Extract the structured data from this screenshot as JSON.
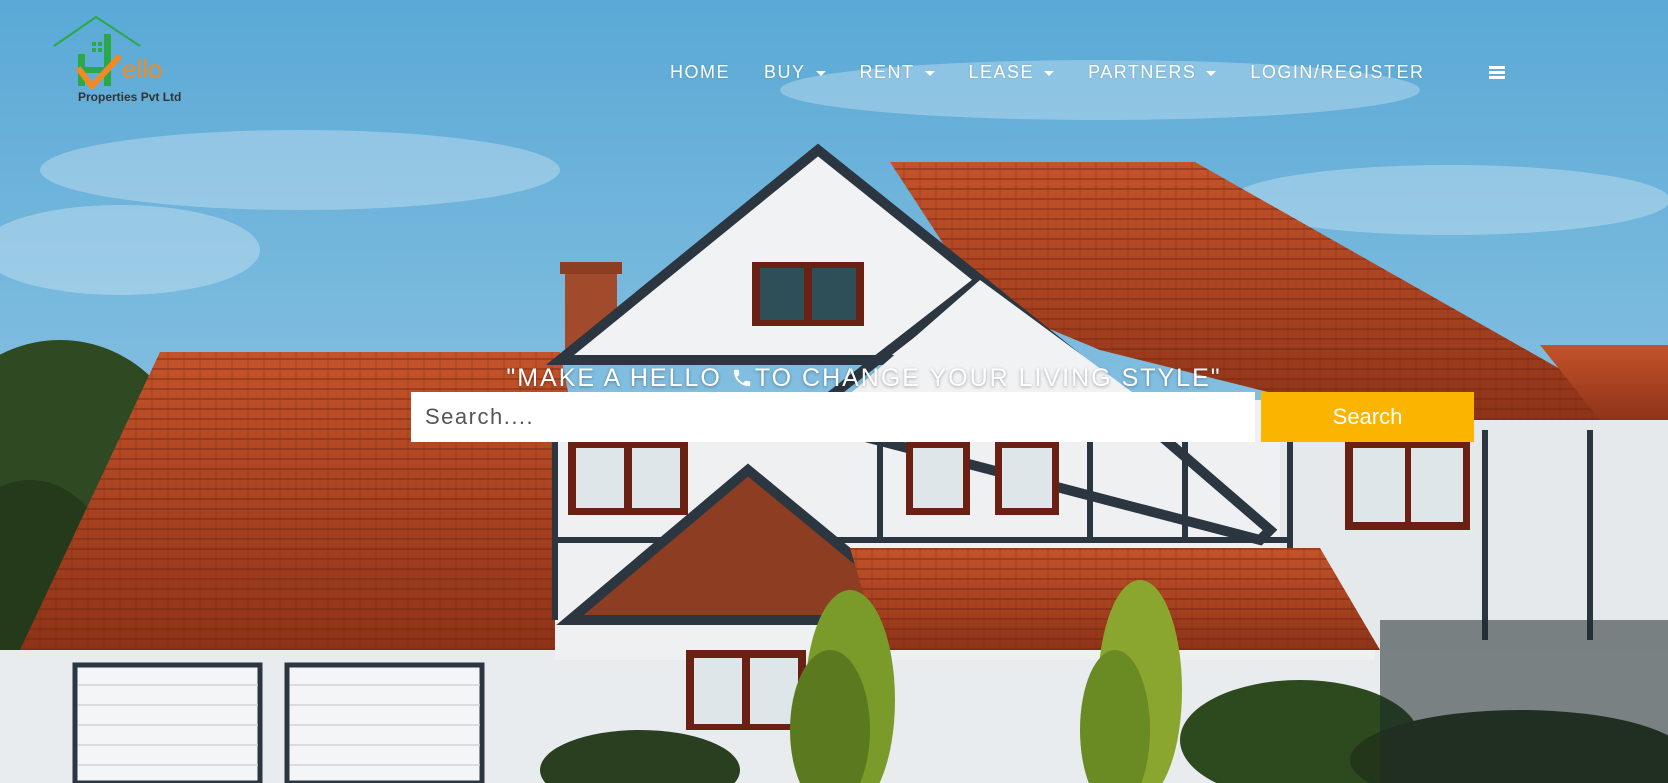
{
  "brand": {
    "logo_letter_h": "H",
    "logo_wordmark": "ello",
    "subtitle": "Properties Pvt Ltd",
    "colors": {
      "green": "#2aa84a",
      "orange": "#f08a24"
    }
  },
  "nav": {
    "items": [
      {
        "label": "HOME",
        "has_dropdown": false
      },
      {
        "label": "BUY",
        "has_dropdown": true
      },
      {
        "label": "RENT",
        "has_dropdown": true
      },
      {
        "label": "LEASE",
        "has_dropdown": true
      },
      {
        "label": "PARTNERS",
        "has_dropdown": true
      },
      {
        "label": "LOGIN/REGISTER",
        "has_dropdown": false
      }
    ],
    "menu_icon": "hamburger-menu-icon"
  },
  "hero": {
    "tagline_start": "\"MAKE A HELLO ",
    "tagline_icon": "phone-icon",
    "tagline_end": "TO CHANGE YOUR LIVING STYLE\"",
    "search": {
      "placeholder": "Search....",
      "value": "",
      "button_label": "Search",
      "button_color": "#fbb500"
    }
  }
}
